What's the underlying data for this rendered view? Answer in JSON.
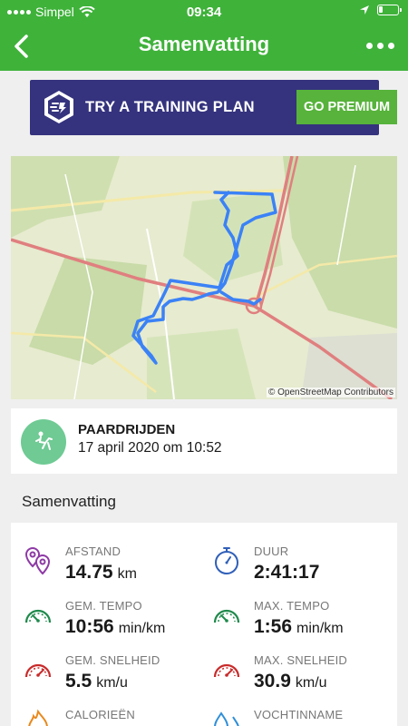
{
  "status_bar": {
    "carrier": "Simpel",
    "time": "09:34"
  },
  "header": {
    "title": "Samenvatting"
  },
  "banner": {
    "text": "TRY A TRAINING PLAN",
    "button": "GO PREMIUM"
  },
  "map": {
    "attribution": "© OpenStreetMap Contributors"
  },
  "activity": {
    "type": "PAARDRIJDEN",
    "date": "17 april 2020 om 10:52"
  },
  "summary": {
    "title": "Samenvatting",
    "stats": [
      {
        "label": "AFSTAND",
        "value": "14.75",
        "unit": "km",
        "icon": "map-pins-icon"
      },
      {
        "label": "DUUR",
        "value": "2:41:17",
        "unit": "",
        "icon": "stopwatch-icon"
      },
      {
        "label": "GEM. TEMPO",
        "value": "10:56",
        "unit": "min/km",
        "icon": "gauge-icon"
      },
      {
        "label": "MAX. TEMPO",
        "value": "1:56",
        "unit": "min/km",
        "icon": "gauge-icon"
      },
      {
        "label": "GEM. SNELHEID",
        "value": "5.5",
        "unit": "km/u",
        "icon": "speedometer-icon"
      },
      {
        "label": "MAX. SNELHEID",
        "value": "30.9",
        "unit": "km/u",
        "icon": "speedometer-icon"
      },
      {
        "label": "CALORIEËN",
        "value": "",
        "unit": "",
        "icon": "flame-icon"
      },
      {
        "label": "VOCHTINNAME",
        "value": "",
        "unit": "",
        "icon": "water-drops-icon"
      }
    ]
  },
  "colors": {
    "header_green": "#3fb23a",
    "banner_purple": "#35337e",
    "button_green": "#57b33b",
    "route_blue": "#3b82f6"
  }
}
